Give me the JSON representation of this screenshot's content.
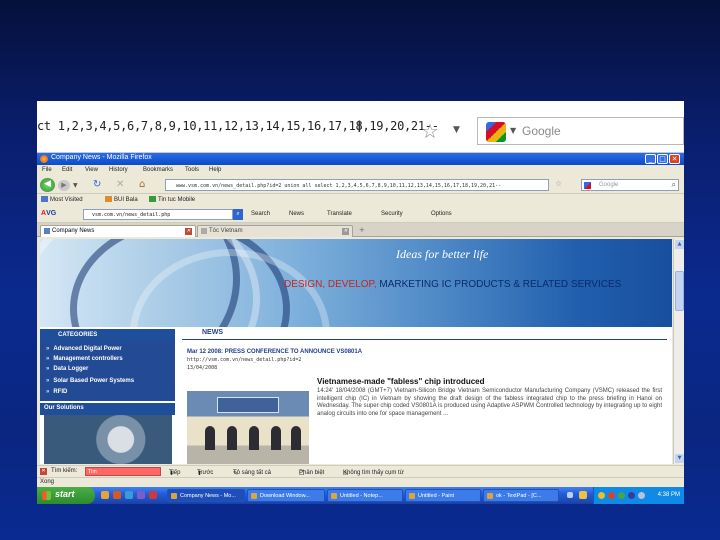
{
  "zoom_strip": {
    "url_text": "ct 1,2,3,4,5,6,7,8,9,10,11,12,13,14,15,16,17,18,19,20,21--",
    "search_placeholder": "Google"
  },
  "window": {
    "title": "Company News - Mozilla Firefox",
    "min_label": "_",
    "max_label": "□",
    "close_label": "✕"
  },
  "menu": [
    "File",
    "Edit",
    "View",
    "History",
    "Bookmarks",
    "Tools",
    "Help"
  ],
  "nav": {
    "url": "www.vsm.com.vn/news_detail.php?id=2 union all select 1,2,3,4,5,6,7,8,9,10,11,12,13,14,15,16,17,18,19,20,21--",
    "search_placeholder": "Google"
  },
  "bookmarks": [
    "Most Visited",
    "BUI Bala",
    "Tin tuc Mobile"
  ],
  "avgbar": {
    "logo_prefix": "A",
    "logo_rest": "VG",
    "url": "vsm.com.vn/news_detail.php",
    "items": [
      "Search",
      "News",
      "Translate",
      "Security",
      "Options"
    ]
  },
  "tabs": [
    {
      "label": "Company News",
      "active": true
    },
    {
      "label": "Tóc Vietnam",
      "active": false
    }
  ],
  "banner": {
    "slogan": "Ideas for better life",
    "tagline_red": "DESIGN, DEVELOP,",
    "tagline_rest": " MARKETING IC PRODUCTS & RELATED SERVICES"
  },
  "sidebar": {
    "categories_heading": "CATEGORIES",
    "categories": [
      "Advanced Digital Power",
      "Management controllers",
      "Data Logger",
      "Solar Based Power Systems",
      "RFID"
    ],
    "solutions_heading": "Our Solutions"
  },
  "news": {
    "section_title": "NEWS",
    "headline": "Mar 12 2008: PRESS CONFERENCE TO ANNOUNCE VS0801A",
    "link": "http://vsm.com.vn/news_detail.php?id=2",
    "date": "13/04/2008",
    "article_title": "Vietnamese-made \"fabless\" chip introduced",
    "article_body": "14:24' 18/04/2008 (GMT+7) Vietnam-Silicon Bridge Vietnam Semiconductor Manufacturing Company (VSMC) released the first intelligent chip (IC) in Vietnam by showing the draft design of the fabless integrated chip to the press briefing in Hanoi on Wednesday. The super chip coded VS0801A is produced using Adaptive ASPWM Controlled technology by integrating up to eight analog circuits into one for space management ..."
  },
  "findbar": {
    "close_label": "✕",
    "find_label": "Tìm kiếm:",
    "find_value": "Tìm",
    "next_label": "Tiếp",
    "prev_label": "Trước",
    "highlight_label": "Tô sáng tất cả",
    "match_case_label": "Phân biệt",
    "status": "Không tìm thấy cụm từ"
  },
  "status": {
    "text": "Xong"
  },
  "taskbar": {
    "start_label": "start",
    "tasks": [
      {
        "label": "Company News - Mo...",
        "active": true
      },
      {
        "label": "Download Window...",
        "active": false
      },
      {
        "label": "Untitled - Notep...",
        "active": false
      },
      {
        "label": "Untitled - Paint",
        "active": false
      },
      {
        "label": "ok - TextPad - [C...",
        "active": false
      }
    ],
    "clock": "4:38 PM"
  }
}
